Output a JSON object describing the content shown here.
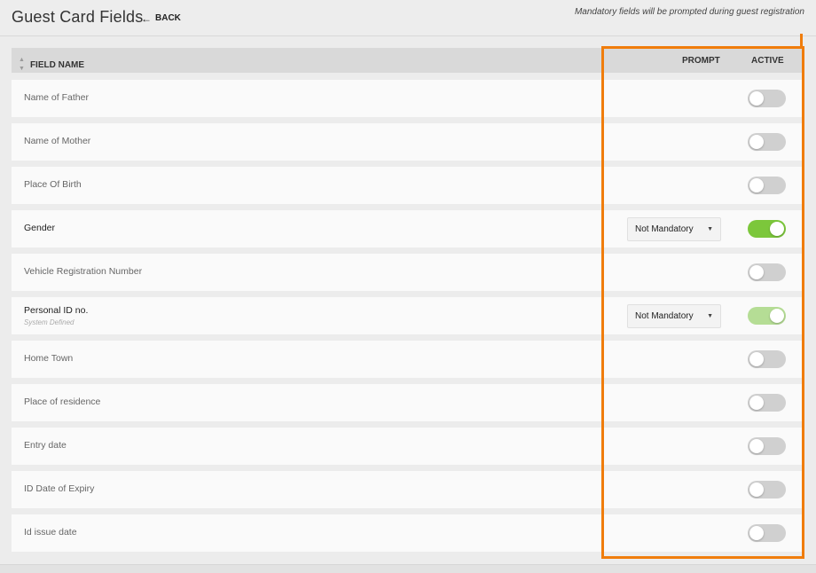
{
  "header": {
    "title": "Guest Card Fields",
    "back_label": "BACK",
    "note": "Mandatory fields will be prompted during guest registration"
  },
  "table": {
    "columns": {
      "field_name": "FIELD NAME",
      "prompt": "PROMPT",
      "active": "ACTIVE"
    },
    "rows": [
      {
        "label": "Name of Father",
        "sublabel": "",
        "prompt": "",
        "active": false
      },
      {
        "label": "Name of Mother",
        "sublabel": "",
        "prompt": "",
        "active": false
      },
      {
        "label": "Place Of Birth",
        "sublabel": "",
        "prompt": "",
        "active": false
      },
      {
        "label": "Gender",
        "sublabel": "",
        "prompt": "Not Mandatory",
        "active": true
      },
      {
        "label": "Vehicle Registration Number",
        "sublabel": "",
        "prompt": "",
        "active": false
      },
      {
        "label": "Personal ID no.",
        "sublabel": "System Defined",
        "prompt": "Not Mandatory",
        "active": true,
        "locked": true
      },
      {
        "label": "Home Town",
        "sublabel": "",
        "prompt": "",
        "active": false
      },
      {
        "label": "Place of residence",
        "sublabel": "",
        "prompt": "",
        "active": false
      },
      {
        "label": "Entry date",
        "sublabel": "",
        "prompt": "",
        "active": false
      },
      {
        "label": "ID Date of Expiry",
        "sublabel": "",
        "prompt": "",
        "active": false
      },
      {
        "label": "Id issue date",
        "sublabel": "",
        "prompt": "",
        "active": false
      }
    ]
  },
  "colors": {
    "toggle_on": "#7cc73b",
    "toggle_on_disabled": "#b5dd95",
    "toggle_off": "#d0d0d0",
    "highlight": "#f07d0c"
  },
  "icons": {
    "back": "arrow-left-icon",
    "sort": "sort-icon",
    "dropdown": "caret-down-icon"
  }
}
